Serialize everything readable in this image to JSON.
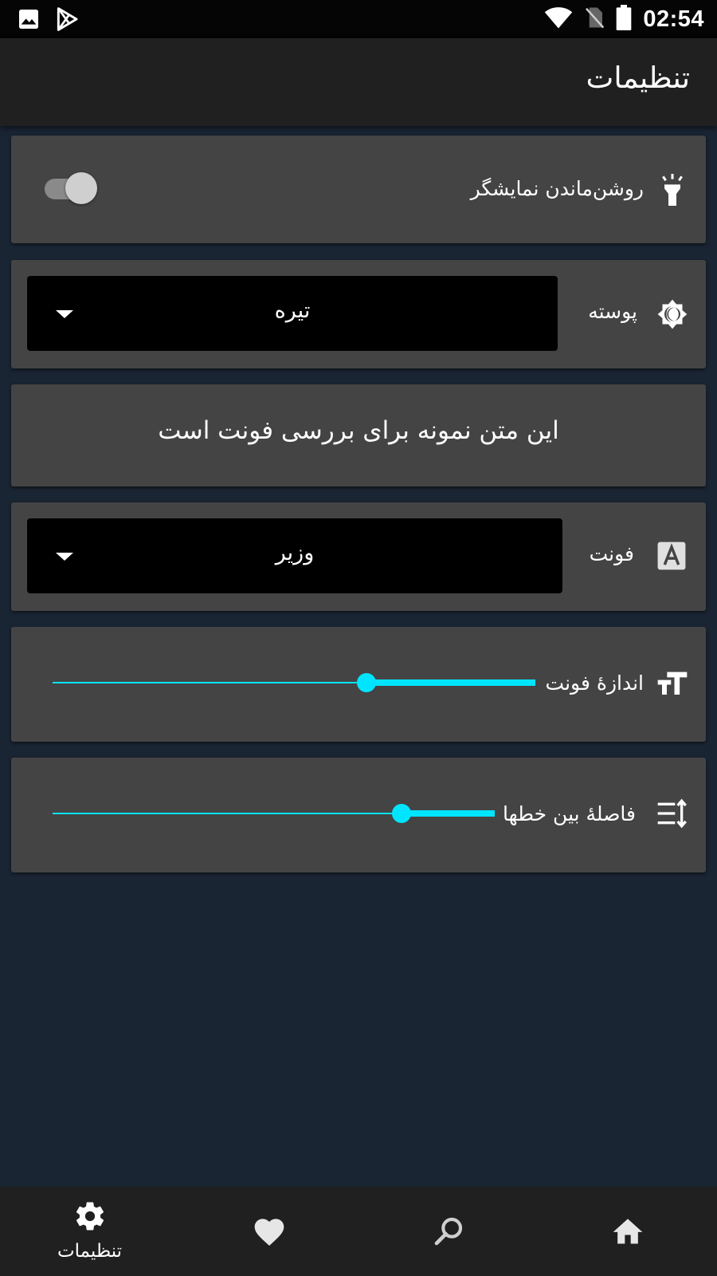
{
  "status_bar": {
    "time": "02:54",
    "icons": [
      "image-icon",
      "play-store-icon",
      "wifi-icon",
      "no-sim-icon",
      "battery-icon"
    ]
  },
  "app_bar": {
    "title": "تنظیمات"
  },
  "settings": {
    "keep_screen_on": {
      "label": "روشن‌ماندن نمایشگر",
      "icon": "flashlight-icon",
      "enabled": true
    },
    "theme": {
      "label": "پوسته",
      "icon": "brightness-icon",
      "selected": "تیره"
    },
    "font_preview": {
      "text": "این متن نمونه برای بررسی فونت است"
    },
    "font": {
      "label": "فونت",
      "icon": "font-letter-icon",
      "selected": "وزیر"
    },
    "font_size": {
      "label": "اندازهٔ فونت",
      "icon": "text-size-icon",
      "fraction": 0.65
    },
    "line_spacing": {
      "label": "فاصلهٔ بین خطها",
      "icon": "line-spacing-icon",
      "fraction": 0.79
    }
  },
  "bottom_nav": {
    "items": [
      {
        "name": "settings",
        "label": "تنظیمات",
        "icon": "gear-icon",
        "active": true
      },
      {
        "name": "favorites",
        "label": "",
        "icon": "heart-icon",
        "active": false
      },
      {
        "name": "search",
        "label": "",
        "icon": "search-icon",
        "active": false
      },
      {
        "name": "home",
        "label": "",
        "icon": "home-icon",
        "active": false
      }
    ]
  },
  "colors": {
    "accent": "#00e5ff",
    "background": "#1a2533",
    "card": "#444444",
    "bar": "#202020"
  }
}
